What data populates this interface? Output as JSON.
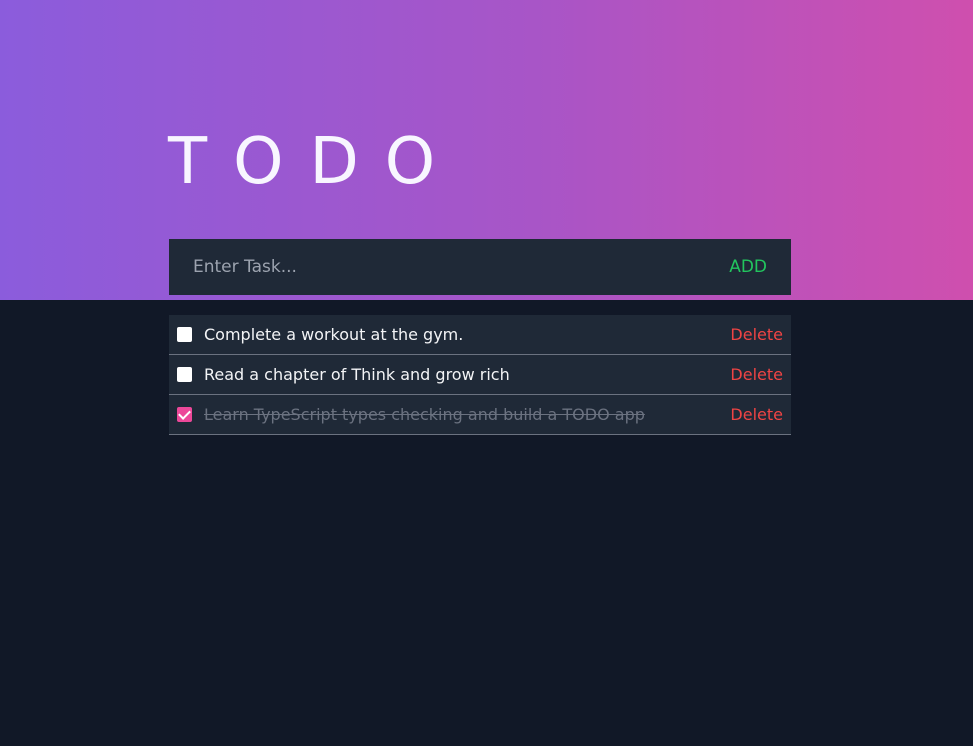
{
  "app": {
    "title": "TODO"
  },
  "new_task": {
    "placeholder": "Enter Task...",
    "value": "",
    "add_label": "ADD"
  },
  "tasks": [
    {
      "text": "Complete a workout at the gym.",
      "completed": false,
      "delete_label": "Delete"
    },
    {
      "text": "Read a chapter of Think and grow rich",
      "completed": false,
      "delete_label": "Delete"
    },
    {
      "text": "Learn TypeScript types checking and build a TODO app",
      "completed": true,
      "delete_label": "Delete"
    }
  ],
  "colors": {
    "gradient_start": "#8b5cdc",
    "gradient_end": "#cf4fae",
    "background": "#111827",
    "panel": "#1f2937",
    "add_accent": "#22c55e",
    "delete_accent": "#ef4444",
    "checked_accent": "#ec4899"
  }
}
